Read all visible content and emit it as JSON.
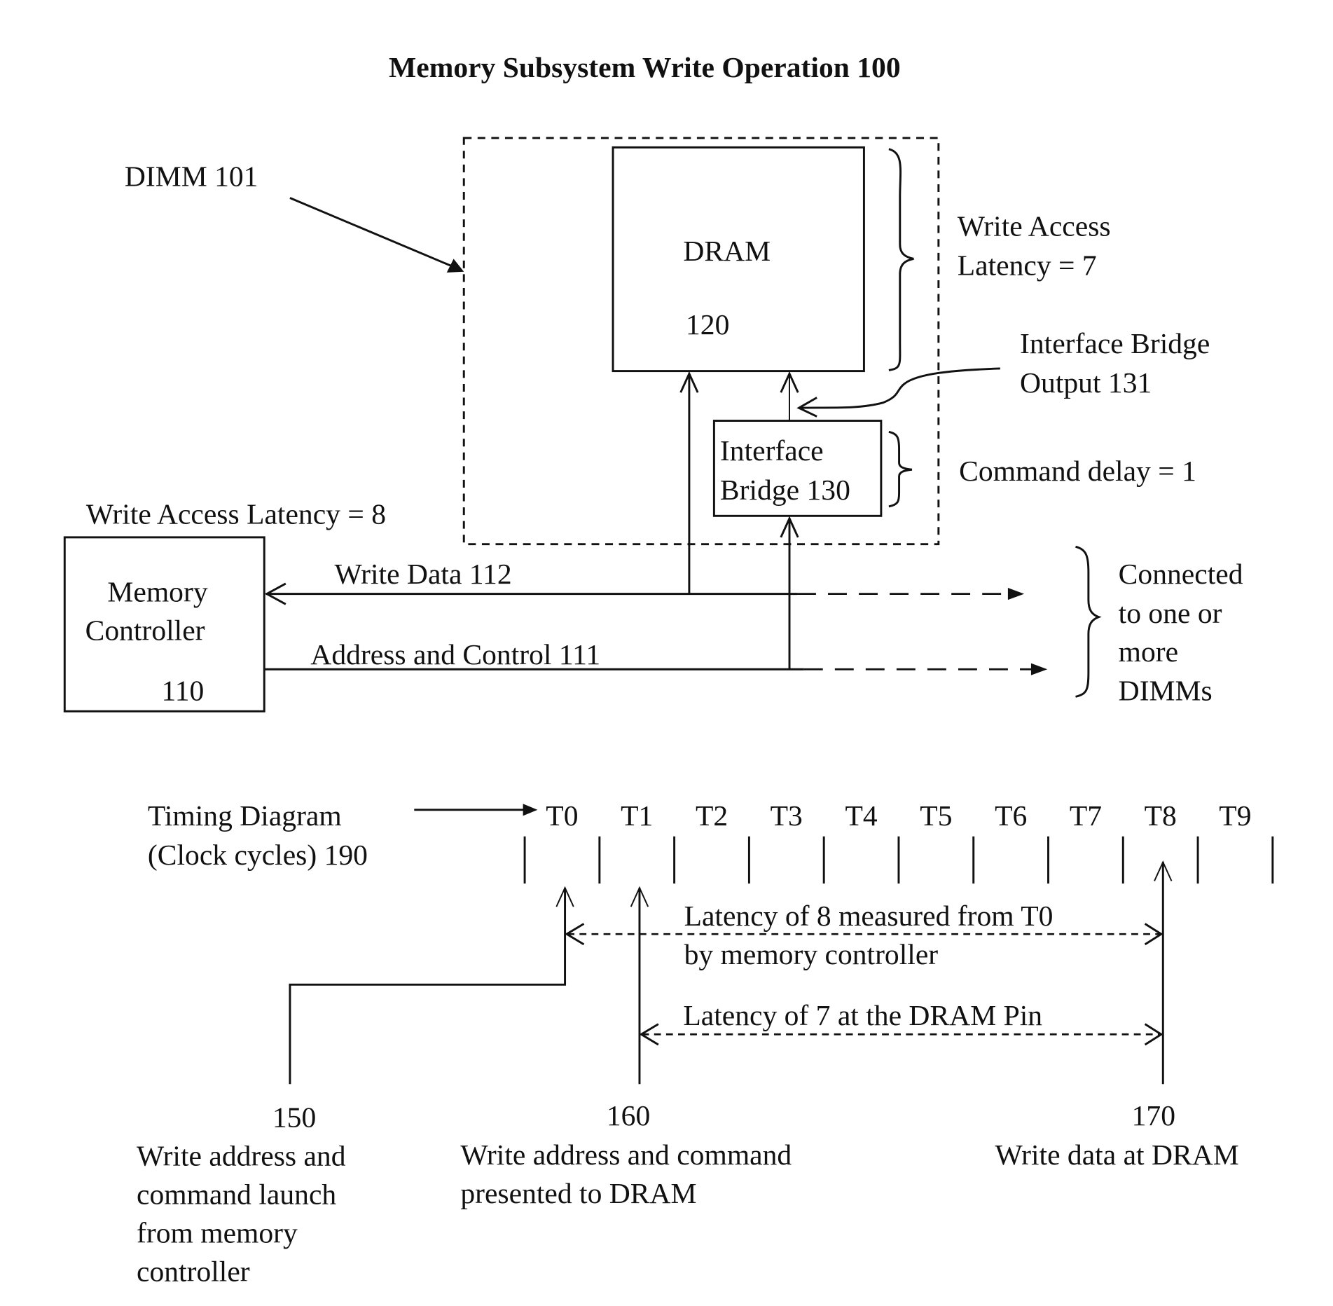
{
  "title": "Memory Subsystem Write Operation 100",
  "dimm": {
    "label": "DIMM  101"
  },
  "dram": {
    "name": "DRAM",
    "ref": "120"
  },
  "dram_latency": {
    "line1": "Write Access",
    "line2": "Latency = 7"
  },
  "bridge_output": {
    "line1": "Interface Bridge",
    "line2": "Output 131"
  },
  "bridge": {
    "line1": "Interface",
    "line2": "Bridge 130"
  },
  "command_delay": "Command delay = 1",
  "controller_latency": "Write Access Latency = 8",
  "controller": {
    "line1": "Memory",
    "line2": "Controller",
    "ref": "110"
  },
  "buses": {
    "write_data": "Write Data   112",
    "address_control": "Address and Control 111"
  },
  "connected": {
    "lines": [
      "Connected",
      "to one or",
      "more",
      "DIMMs"
    ]
  },
  "timing": {
    "label_line1": "Timing Diagram",
    "label_line2": "(Clock cycles) 190",
    "cycles": [
      "T0",
      "T1",
      "T2",
      "T3",
      "T4",
      "T5",
      "T6",
      "T7",
      "T8",
      "T9"
    ]
  },
  "latency8": {
    "line1": "Latency of 8 measured from T0",
    "line2": "by memory controller"
  },
  "latency7": "Latency of 7 at the DRAM Pin",
  "events": [
    {
      "ref": "150",
      "lines": [
        "Write address and",
        "command launch",
        "from memory",
        "controller"
      ]
    },
    {
      "ref": "160",
      "lines": [
        "Write address and command",
        "presented to DRAM"
      ]
    },
    {
      "ref": "170",
      "lines": [
        "Write data at DRAM"
      ]
    }
  ]
}
